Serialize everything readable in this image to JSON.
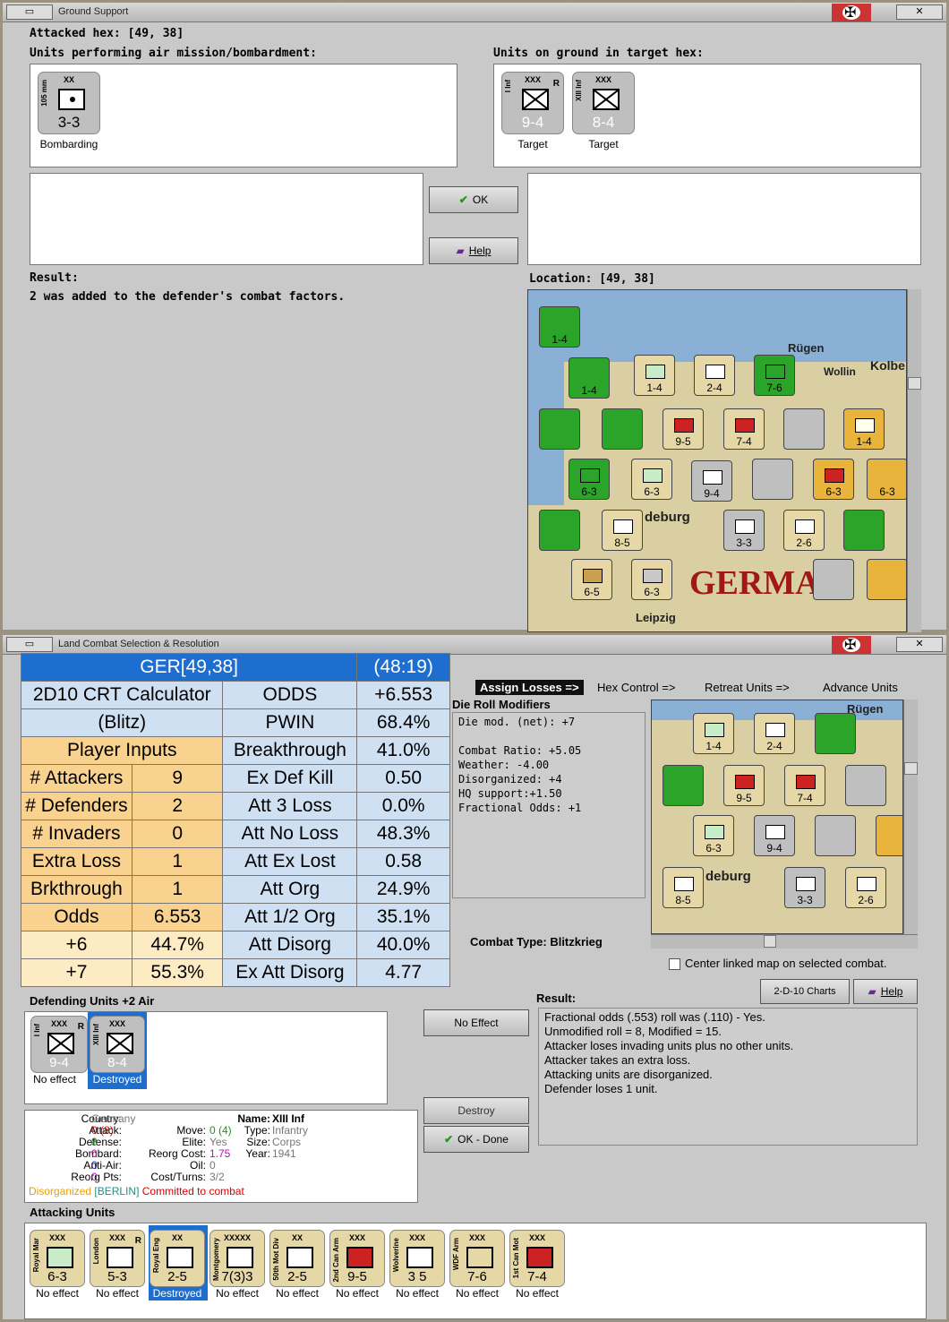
{
  "gs": {
    "title": "Ground Support",
    "attacked_hex": "Attacked hex: [49, 38]",
    "air_label": "Units performing air mission/bombardment:",
    "ground_label": "Units on ground in target hex:",
    "air_unit": {
      "size": "XX",
      "name": "105 mm",
      "factors": "3-3",
      "status": "Bombarding"
    },
    "ground_units": [
      {
        "size": "XXX",
        "name": "I Inf",
        "flag": "R",
        "factors": "9-4",
        "status": "Target"
      },
      {
        "size": "XXX",
        "name": "XIII Inf",
        "flag": "",
        "factors": "8-4",
        "status": "Target"
      }
    ],
    "ok": "OK",
    "help": "Help",
    "result_label": "Result:",
    "result_text": "2 was added to the defender's combat factors.",
    "location": "Location:  [49, 38]"
  },
  "map": {
    "labels": [
      "Rügen",
      "Wollin",
      "Kolbe",
      "GERMA",
      "deburg",
      "Leipzig"
    ],
    "counters": [
      "1-4",
      "2-4",
      "7-6",
      "9-5",
      "7-4",
      "1-4",
      "6-3",
      "6-3",
      "6-3",
      "6-3",
      "2-6",
      "6-5",
      "6-3",
      "9-4",
      "3-3",
      "8-5"
    ]
  },
  "lc": {
    "title": "Land Combat Selection & Resolution",
    "crt": {
      "hdr_left": "GER[49,38]",
      "hdr_right": "(48:19)",
      "calc1": "2D10 CRT Calculator",
      "calc2": "(Blitz)",
      "player_inputs": "Player Inputs",
      "left": [
        [
          "# Attackers",
          "9"
        ],
        [
          "# Defenders",
          "2"
        ],
        [
          "# Invaders",
          "0"
        ],
        [
          "Extra Loss",
          "1"
        ],
        [
          "Brkthrough",
          "1"
        ],
        [
          "Odds",
          "6.553"
        ],
        [
          "+6",
          "44.7%"
        ],
        [
          "+7",
          "55.3%"
        ]
      ],
      "right": [
        [
          "ODDS",
          "+6.553"
        ],
        [
          "PWIN",
          "68.4%"
        ],
        [
          "Breakthrough",
          "41.0%"
        ],
        [
          "Ex Def Kill",
          "0.50"
        ],
        [
          "Att 3 Loss",
          "0.0%"
        ],
        [
          "Att No Loss",
          "48.3%"
        ],
        [
          "Att Ex Lost",
          "0.58"
        ],
        [
          "Att Org",
          "24.9%"
        ],
        [
          "Att 1/2 Org",
          "35.1%"
        ],
        [
          "Att Disorg",
          "40.0%"
        ],
        [
          "Ex Att Disorg",
          "4.77"
        ]
      ]
    },
    "tabs": [
      "Assign Losses =>",
      "Hex Control =>",
      "Retreat Units =>",
      "Advance Units"
    ],
    "die_label": "Die Roll Modifiers",
    "die_lines": [
      "Die mod. (net): +7",
      "",
      "Combat Ratio: +5.05",
      "Weather: -4.00",
      "Disorganized: +4",
      "HQ support:+1.50",
      "Fractional Odds: +1"
    ],
    "combat_type": "Combat Type:  Blitzkrieg",
    "center_chk": "Center linked map on selected combat.",
    "charts_btn": "2-D-10 Charts",
    "help": "Help",
    "def_label": "Defending Units +2 Air",
    "def_units": [
      {
        "size": "XXX",
        "name": "I Inf",
        "flag": "R",
        "factors": "9-4",
        "status": "No effect"
      },
      {
        "size": "XXX",
        "name": "XIII Inf",
        "flag": "",
        "factors": "8-4",
        "status": "Destroyed"
      }
    ],
    "no_effect_btn": "No Effect",
    "destroy_btn": "Destroy",
    "ok_done": "OK - Done",
    "result_label": "Result:",
    "result_lines": [
      "Fractional odds (.553) roll was (.110)  - Yes.",
      "Unmodified roll = 8, Modified = 15.",
      "Attacker loses invading units plus no other units.",
      "Attacker takes an extra loss.",
      "Attacking units are disorganized.",
      "Defender loses 1 unit."
    ],
    "info": {
      "country_k": "Country:",
      "country_v": "Germany",
      "attack_k": "Attack:",
      "attack_v": "0",
      "attack_v2": "(8)",
      "defense_k": "Defense:",
      "defense_v": "8",
      "bombard_k": "Bombard:",
      "bombard_v": "0",
      "aa_k": "Anti-Air:",
      "aa_v": "0",
      "reorg_k": "Reorg Pts:",
      "reorg_v": "0",
      "move_k": "Move:",
      "move_v": "0 (4)",
      "elite_k": "Elite:",
      "elite_v": "Yes",
      "rcost_k": "Reorg Cost:",
      "rcost_v": "1.75",
      "oil_k": "Oil:",
      "oil_v": "0",
      "ct_k": "Cost/Turns:",
      "ct_v": "3/2",
      "name_k": "Name:",
      "name_v": "XIII Inf",
      "type_k": "Type:",
      "type_v": "Infantry",
      "size_k": "Size:",
      "size_v": "Corps",
      "year_k": "Year:",
      "year_v": "1941",
      "st1": "Disorganized",
      "st2": "[BERLIN]",
      "st3": "Committed to combat"
    },
    "att_label": "Attacking Units",
    "att_units": [
      {
        "size": "XXX",
        "name": "Royal Mar",
        "factors": "6-3",
        "status": "No effect"
      },
      {
        "size": "XXX",
        "name": "London",
        "factors": "5-3",
        "status": "No effect",
        "flag": "R"
      },
      {
        "size": "XX",
        "name": "Royal Eng",
        "factors": "2-5",
        "status": "Destroyed"
      },
      {
        "size": "XXXXX",
        "name": "Montgomery",
        "factors": "7(3)3",
        "status": "No effect"
      },
      {
        "size": "XX",
        "name": "50th Mot Div",
        "factors": "2-5",
        "status": "No effect"
      },
      {
        "size": "XXX",
        "name": "2nd Can Arm",
        "factors": "9-5",
        "status": "No effect"
      },
      {
        "size": "XXX",
        "name": "Wolverine",
        "factors": "3 5",
        "status": "No effect"
      },
      {
        "size": "XXX",
        "name": "WDF Arm",
        "factors": "7-6",
        "status": "No effect"
      },
      {
        "size": "XXX",
        "name": "1st Can Mot",
        "factors": "7-4",
        "status": "No effect"
      }
    ]
  },
  "colors": {
    "accent": "#1e6ed0",
    "crt_blue": "#cfe0f2",
    "crt_orange": "#f8d28e",
    "destroyed_bg": "#1e6ed0"
  }
}
